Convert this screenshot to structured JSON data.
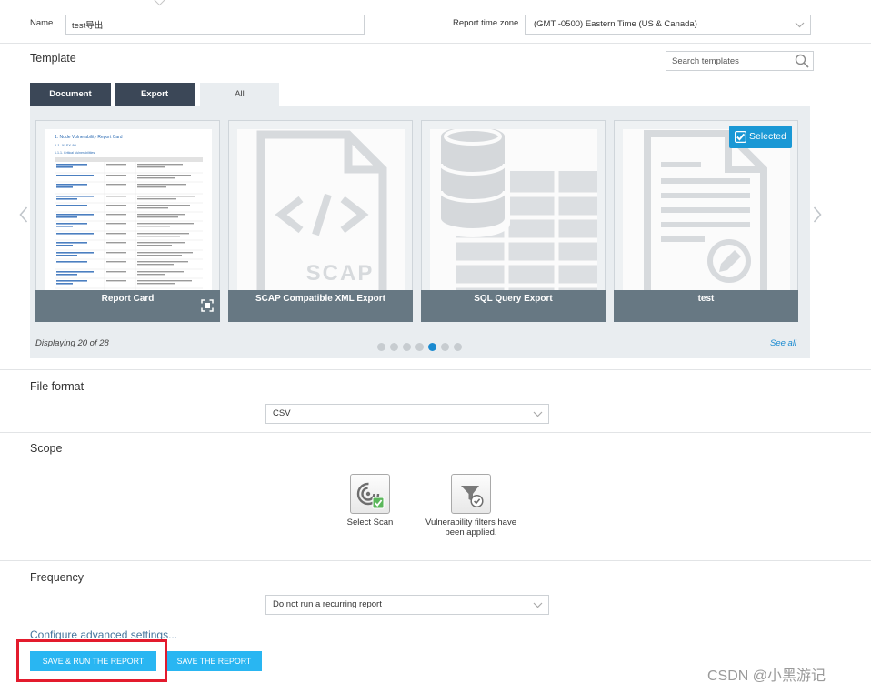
{
  "form": {
    "name_label": "Name",
    "name_value": "test导出",
    "timezone_label": "Report time zone",
    "timezone_value": "(GMT -0500) Eastern Time (US & Canada)"
  },
  "template": {
    "heading": "Template",
    "search_placeholder": "Search templates",
    "tabs": [
      {
        "label": "Document",
        "active": false
      },
      {
        "label": "Export",
        "active": false
      },
      {
        "label": "All",
        "active": true
      }
    ],
    "cards": [
      {
        "title": "Report Card",
        "icon": "report-document-thumbnail",
        "thumbnail": {
          "title": "1. Node Vulnerability Report Card",
          "section": "1.1. XLSX-80",
          "subsection": "1.1.1. Critical Vulnerabilities"
        }
      },
      {
        "title": "SCAP Compatible XML Export",
        "icon": "scap-code-file-icon",
        "icon_text": "SCAP"
      },
      {
        "title": "SQL Query Export",
        "icon": "database-table-icon"
      },
      {
        "title": "test",
        "icon": "document-edit-icon",
        "selected": true
      }
    ],
    "selected_badge": "Selected",
    "displaying": "Displaying 20 of 28",
    "see_all": "See all",
    "pagination": {
      "pages": 7,
      "current": 5
    }
  },
  "file_format": {
    "heading": "File format",
    "value": "CSV"
  },
  "scope": {
    "heading": "Scope",
    "options": [
      {
        "label": "Select Scan",
        "icon": "scan-radar-icon"
      },
      {
        "label": "Vulnerability filters have been applied.",
        "icon": "filter-check-icon"
      }
    ]
  },
  "frequency": {
    "heading": "Frequency",
    "value": "Do not run a recurring report"
  },
  "advanced_settings_link": "Configure advanced settings...",
  "actions": {
    "save_run": "SAVE & RUN THE REPORT",
    "save": "SAVE THE REPORT"
  },
  "watermark": "CSDN @小黑游记",
  "colors": {
    "accent": "#29b6f2",
    "tab_dark": "#3b4757",
    "card_label": "#677883",
    "selected_badge": "#1a98d5",
    "panel_bg": "#e9edf0",
    "link": "#1a8ad0",
    "annotation_red": "#e31b2d"
  }
}
